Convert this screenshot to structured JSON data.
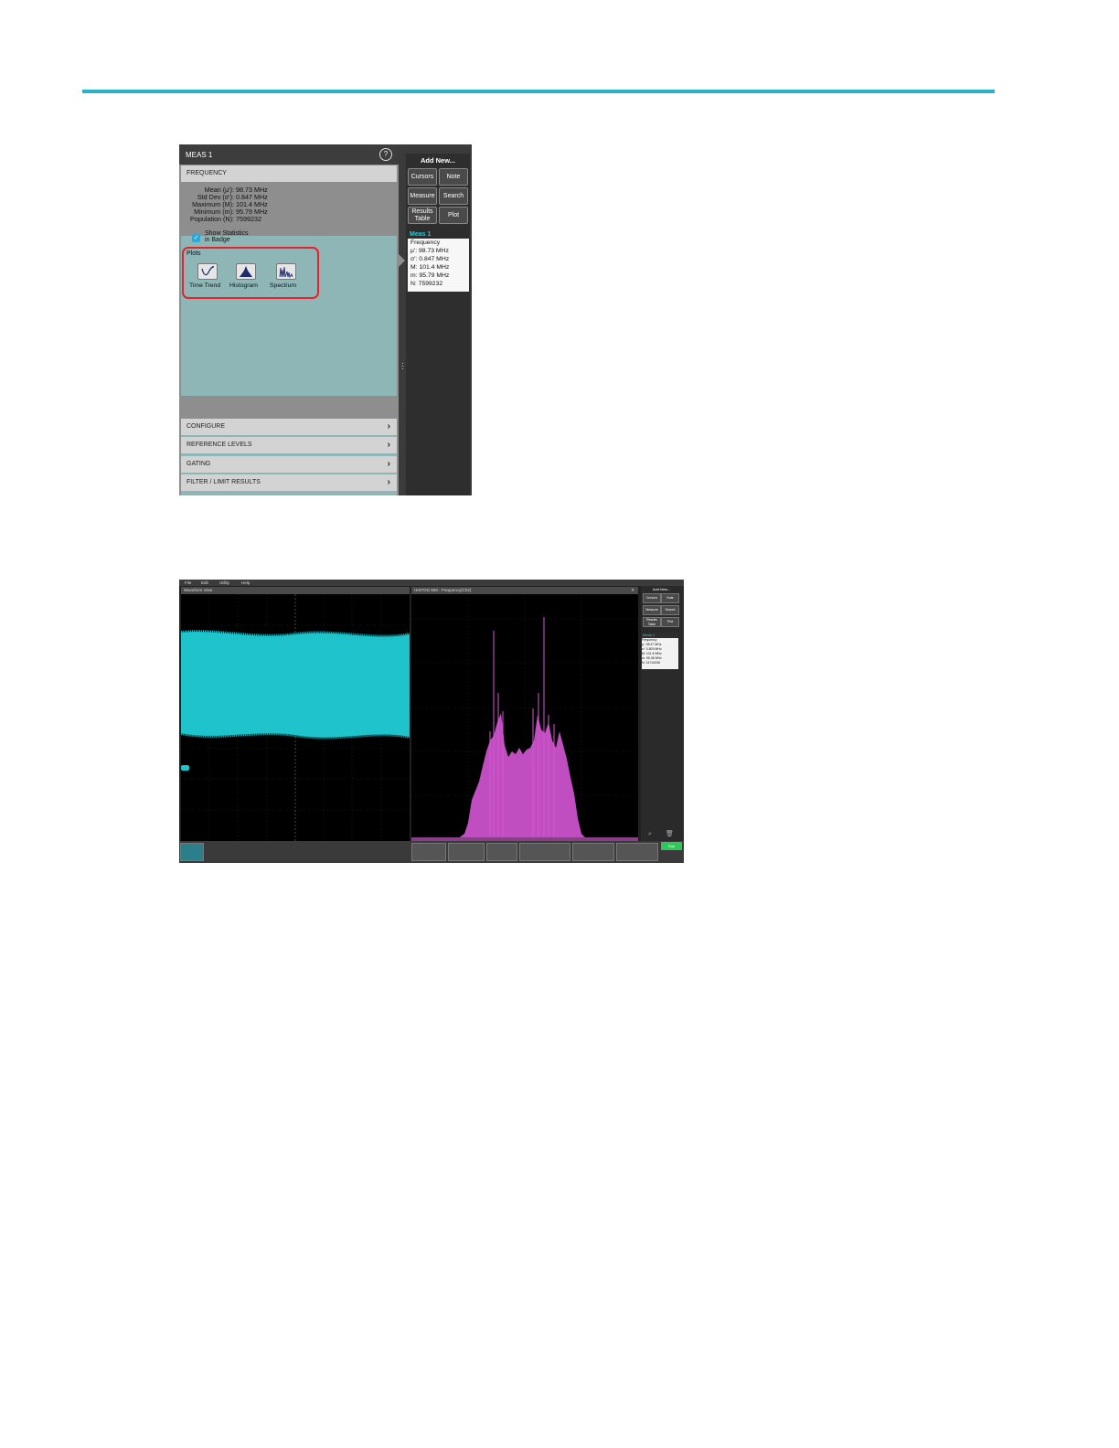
{
  "panel": {
    "title": "MEAS 1",
    "help_glyph": "?",
    "section_frequency": "FREQUENCY",
    "stats": [
      {
        "label": "Mean (µ'):",
        "value": "98.73 MHz"
      },
      {
        "label": "Std Dev (σ'):",
        "value": "0.847 MHz"
      },
      {
        "label": "Maximum (M):",
        "value": "101.4 MHz"
      },
      {
        "label": "Minimum (m):",
        "value": "95.79 MHz"
      },
      {
        "label": "Population (N):",
        "value": "7599232"
      }
    ],
    "show_stats_checked": true,
    "show_stats_label_1": "Show Statistics",
    "show_stats_label_2": "in Badge",
    "plots_label": "Plots",
    "plot_buttons": [
      {
        "label": "Time Trend",
        "icon": "time-trend-icon"
      },
      {
        "label": "Histogram",
        "icon": "histogram-icon"
      },
      {
        "label": "Spectrum",
        "icon": "spectrum-icon"
      }
    ],
    "sections": [
      "CONFIGURE",
      "REFERENCE LEVELS",
      "GATING",
      "FILTER / LIMIT RESULTS"
    ]
  },
  "side": {
    "add_new": "Add New...",
    "buttons": [
      "Cursors",
      "Note",
      "Measure",
      "Search"
    ],
    "results_table_1": "Results",
    "results_table_2": "Table",
    "plot": "Plot",
    "badge_title": "Meas 1",
    "badge_lines": [
      "Frequency",
      "µ': 98.73 MHz",
      "σ': 0.847 MHz",
      "M: 101.4 MHz",
      "m: 95.79 MHz",
      "N: 7599232"
    ]
  },
  "scope": {
    "menu": [
      "File",
      "Edit",
      "Utility",
      "Help"
    ],
    "waveform_view": "Waveform View",
    "spectrum_title": "HISTOG MM - Frequency(Ch2)",
    "add_new": "Add New...",
    "side_buttons": [
      "Cursors",
      "Note",
      "Measure",
      "Search",
      "Results Table",
      "Plot"
    ],
    "badge_title": "Meas 1",
    "badge_lines": [
      "Frequency",
      "µ': 98.47 MHz",
      "σ': 0.809 MHz",
      "M: 101.8 MHz",
      "m: 95.08 MHz",
      "N: 14710036"
    ],
    "run": "Run",
    "colors": {
      "waveform": "#1fc3cc",
      "spectrum": "#d257d2",
      "accent": "#2ab3c6",
      "highlight": "#e8212b"
    }
  }
}
